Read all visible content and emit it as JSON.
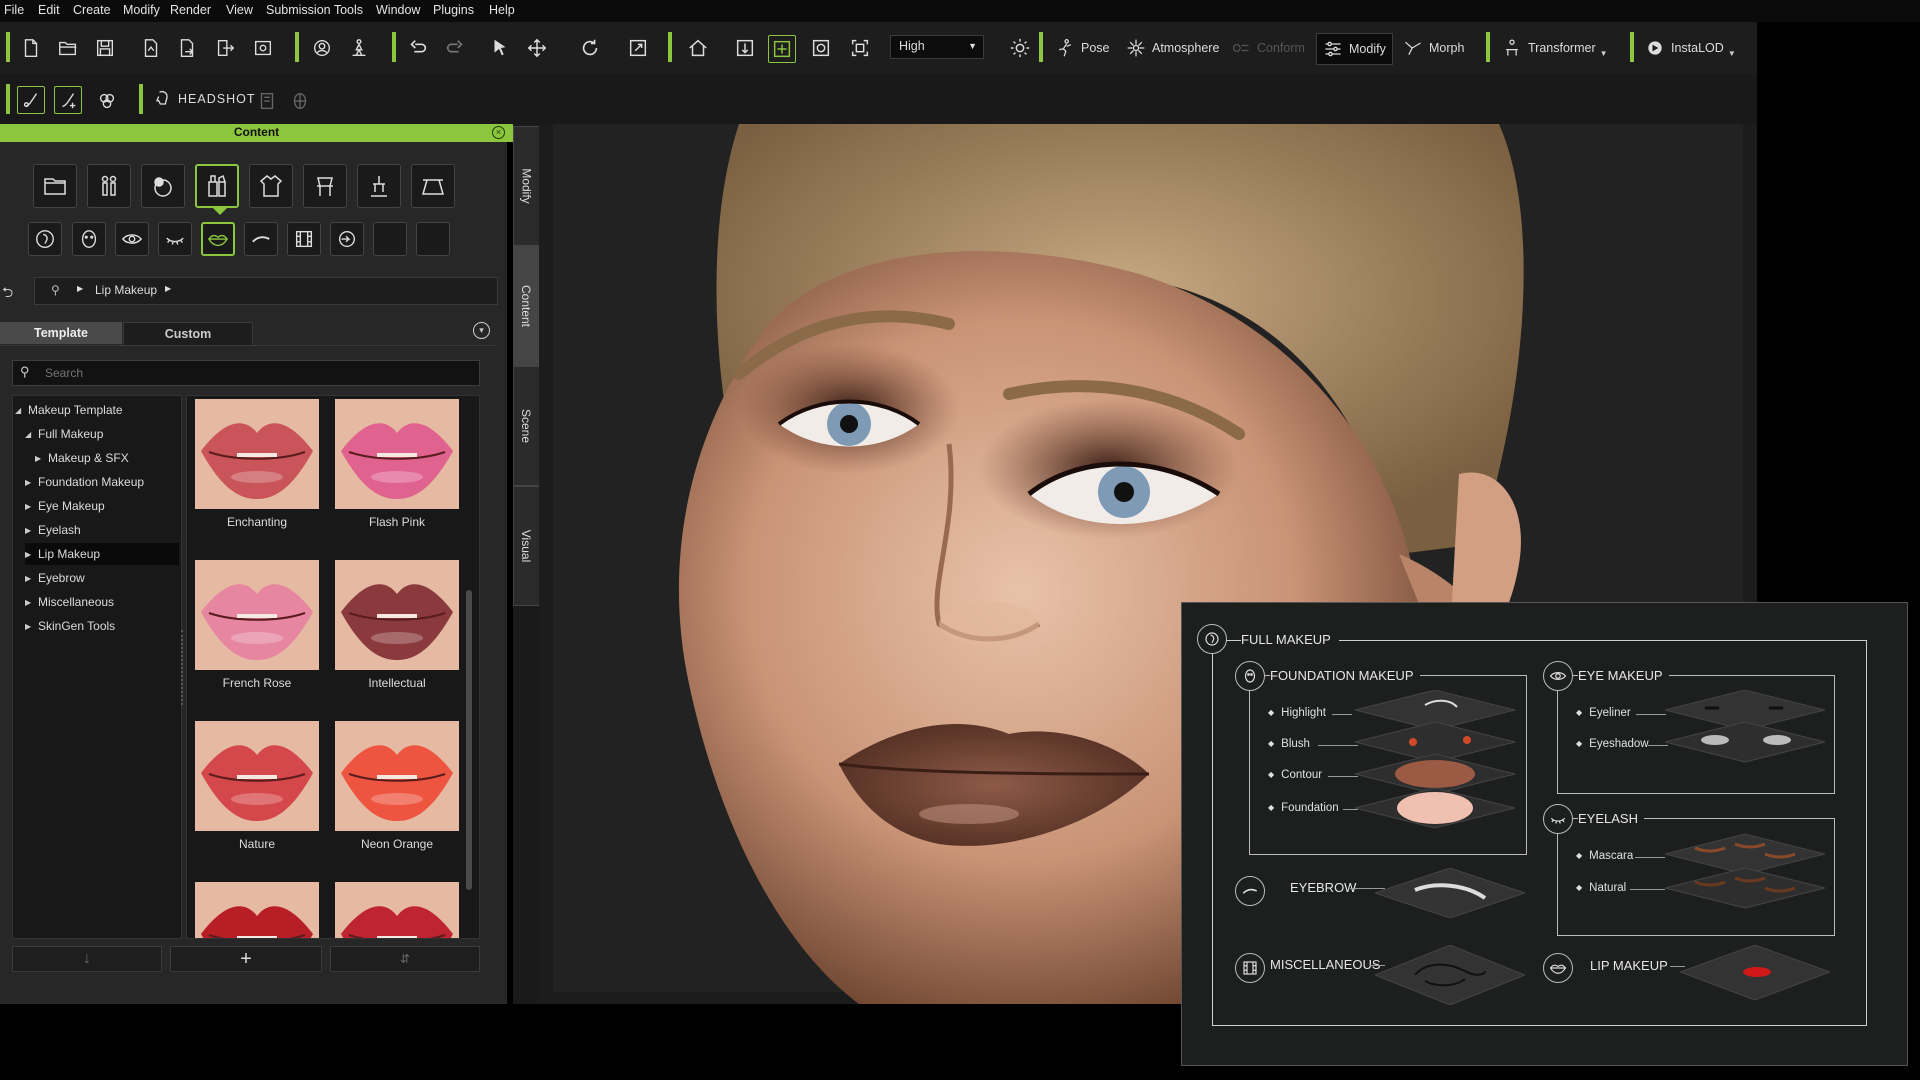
{
  "menu": [
    "File",
    "Edit",
    "Create",
    "Modify",
    "Render",
    "View",
    "Submission Tools",
    "Window",
    "Plugins",
    "Help"
  ],
  "toolbar": {
    "quality": "High",
    "buttons": {
      "pose": "Pose",
      "atmosphere": "Atmosphere",
      "conform": "Conform",
      "modify": "Modify",
      "morph": "Morph",
      "transformer": "Transformer",
      "instalod": "InstaLOD"
    },
    "headshot": "HEADSHOT"
  },
  "panel": {
    "title": "Content",
    "breadcrumb": "Lip Makeup",
    "tabs": [
      "Template",
      "Custom"
    ],
    "search_placeholder": "Search",
    "tree": [
      {
        "label": "Makeup Template",
        "level": 0,
        "expanded": true
      },
      {
        "label": "Full Makeup",
        "level": 1,
        "expanded": true
      },
      {
        "label": "Makeup & SFX",
        "level": 2,
        "expanded": false
      },
      {
        "label": "Foundation Makeup",
        "level": 1,
        "expanded": false
      },
      {
        "label": "Eye Makeup",
        "level": 1,
        "expanded": false
      },
      {
        "label": "Eyelash",
        "level": 1,
        "expanded": false
      },
      {
        "label": "Lip Makeup",
        "level": 1,
        "expanded": false,
        "selected": true
      },
      {
        "label": "Eyebrow",
        "level": 1,
        "expanded": false
      },
      {
        "label": "Miscellaneous",
        "level": 1,
        "expanded": false
      },
      {
        "label": "SkinGen Tools",
        "level": 1,
        "expanded": false
      }
    ],
    "items": [
      {
        "label": "Enchanting",
        "color": "#c9555a"
      },
      {
        "label": "Flash Pink",
        "color": "#e0638f"
      },
      {
        "label": "French Rose",
        "color": "#e686a0"
      },
      {
        "label": "Intellectual",
        "color": "#8a3a3c"
      },
      {
        "label": "Nature",
        "color": "#d4474a"
      },
      {
        "label": "Neon Orange",
        "color": "#ee5540"
      },
      {
        "label": "",
        "color": "#b81e25"
      },
      {
        "label": "",
        "color": "#bf2530"
      }
    ]
  },
  "side_tabs": [
    "Modify",
    "Content",
    "Scene",
    "Visual"
  ],
  "overlay": {
    "title": "FULL MAKEUP",
    "sections": {
      "foundation": {
        "title": "FOUNDATION MAKEUP",
        "items": [
          "Highlight",
          "Blush",
          "Contour",
          "Foundation"
        ]
      },
      "eye": {
        "title": "EYE MAKEUP",
        "items": [
          "Eyeliner",
          "Eyeshadow"
        ]
      },
      "eyelash": {
        "title": "EYELASH",
        "items": [
          "Mascara",
          "Natural"
        ]
      },
      "eyebrow": {
        "title": "EYEBROW"
      },
      "misc": {
        "title": "MISCELLANEOUS"
      },
      "lip": {
        "title": "LIP MAKEUP"
      }
    }
  },
  "colors": {
    "accent": "#8cc63f"
  }
}
